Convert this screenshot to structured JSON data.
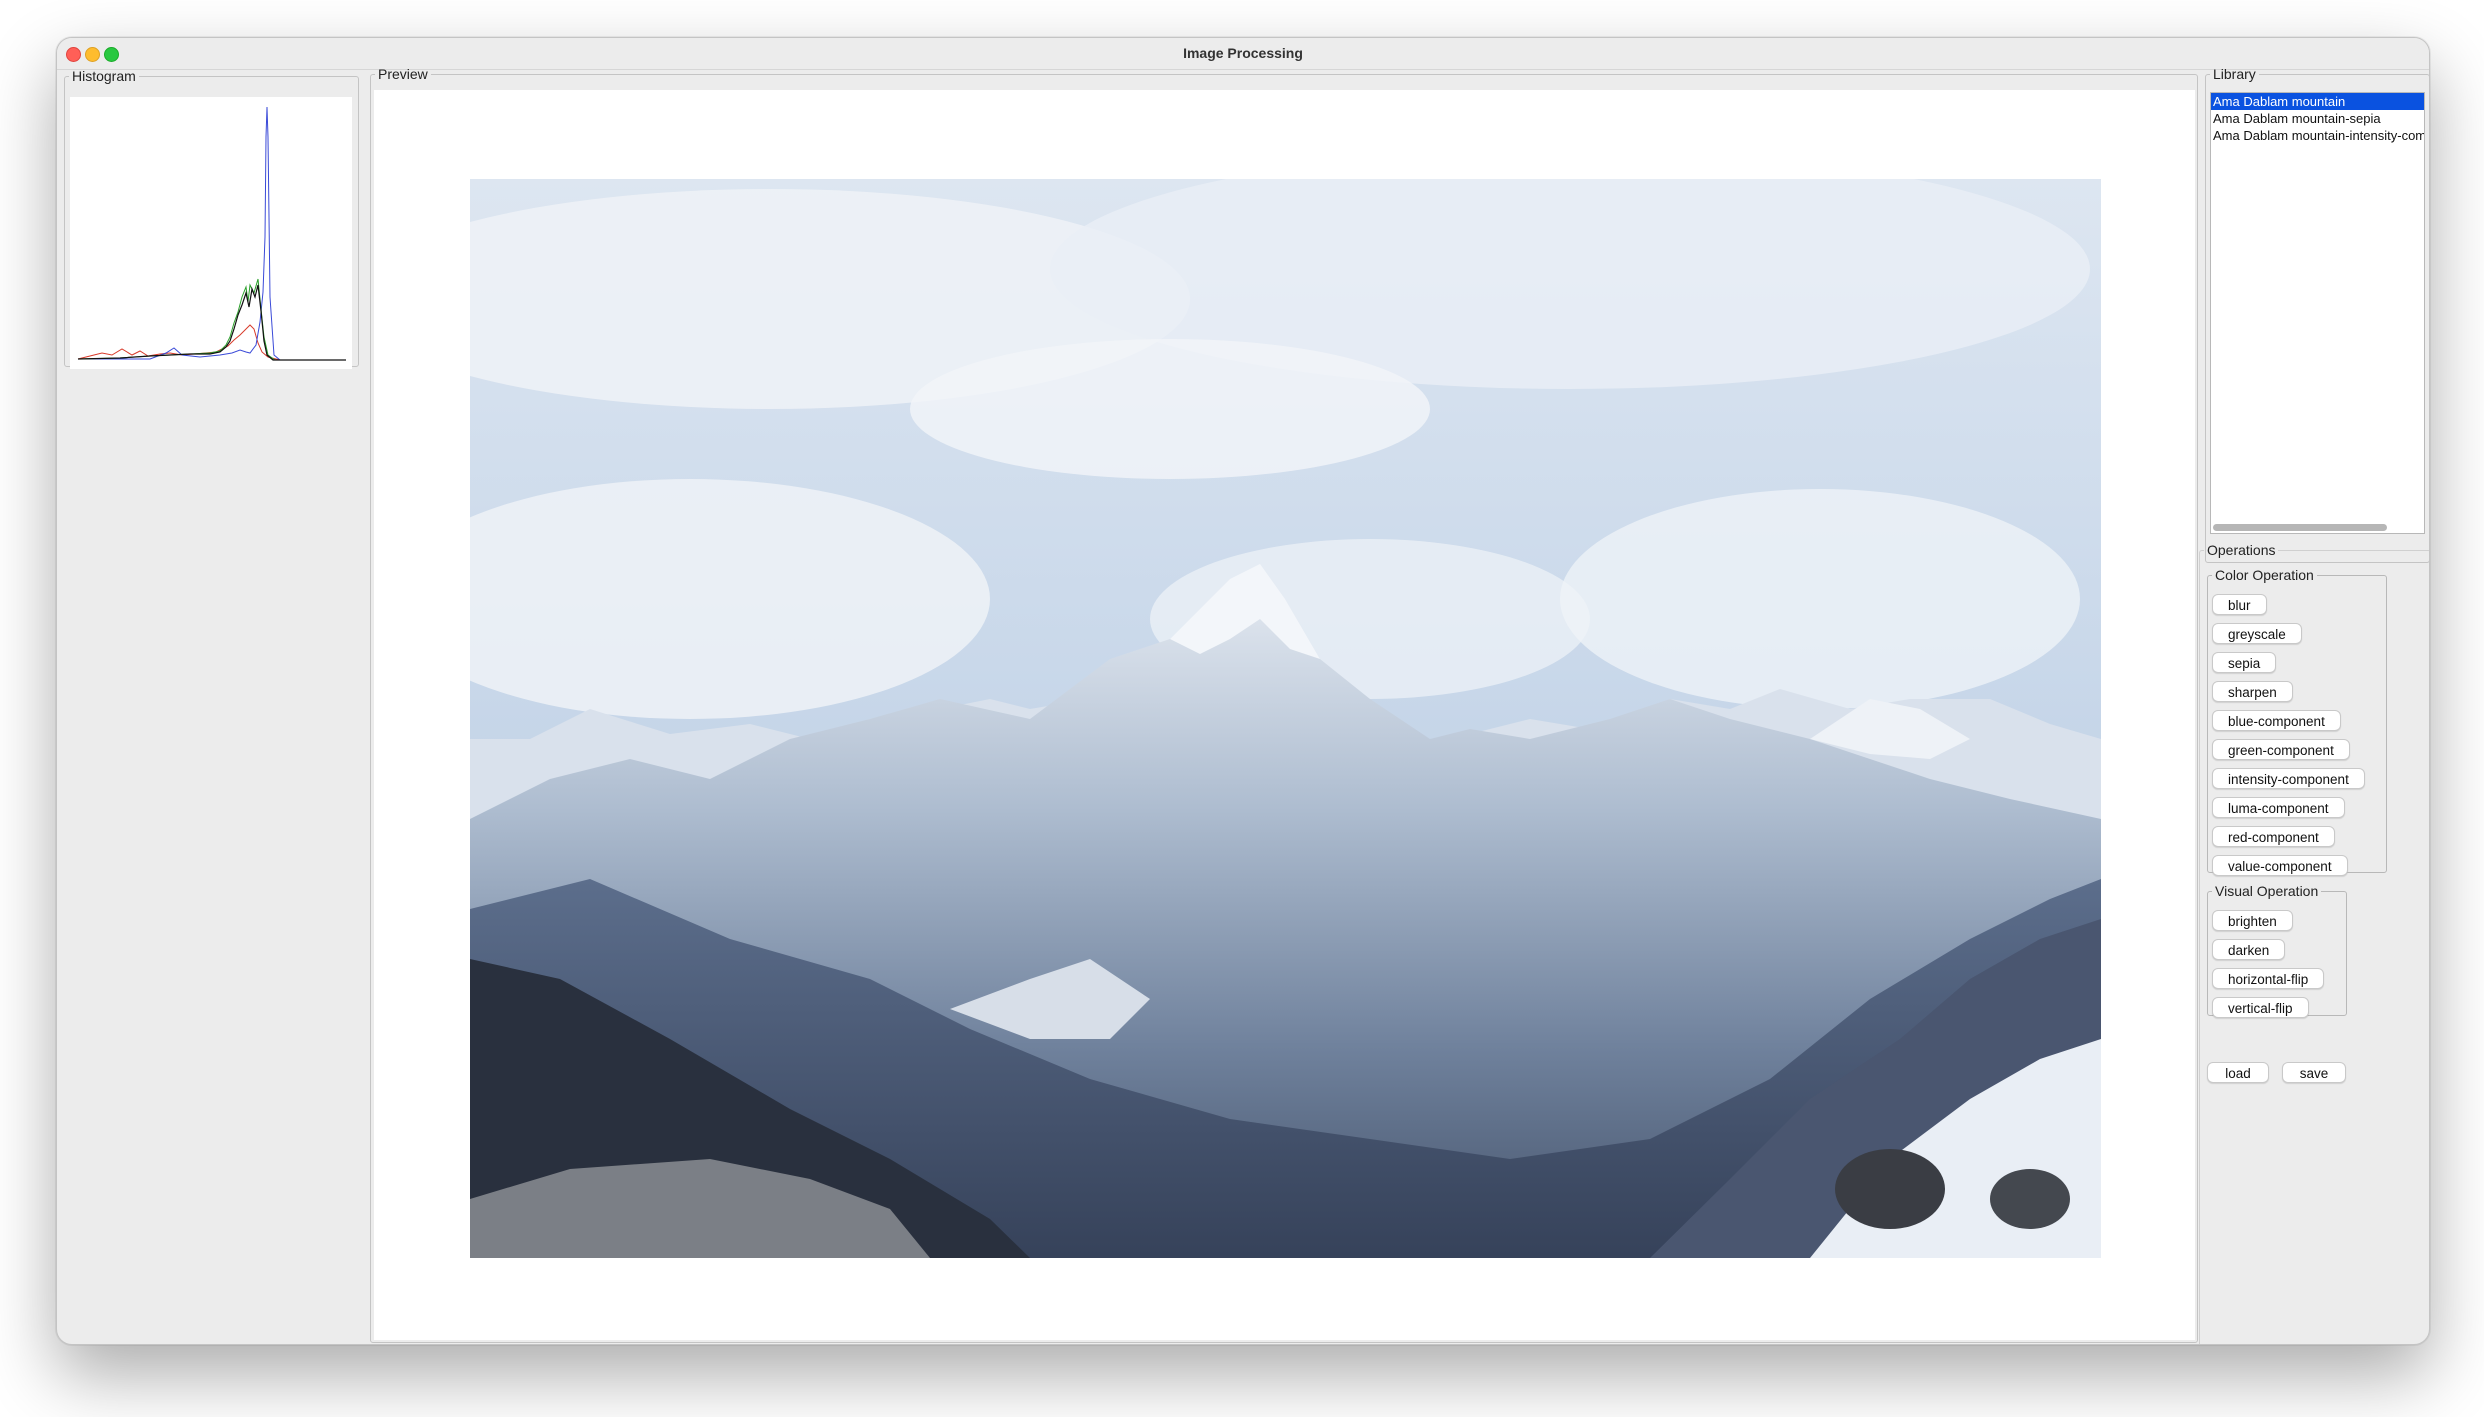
{
  "window": {
    "title": "Image Processing"
  },
  "histogram": {
    "legend": "Histogram",
    "colors": {
      "red": "#d83a2a",
      "green": "#2aa02a",
      "blue": "#3a4ad8",
      "intensity": "#111111"
    }
  },
  "preview": {
    "legend": "Preview"
  },
  "library": {
    "legend": "Library",
    "items": [
      {
        "label": "Ama Dablam mountain",
        "selected": true
      },
      {
        "label": "Ama Dablam mountain-sepia",
        "selected": false
      },
      {
        "label": "Ama Dablam mountain-intensity-component",
        "selected": false
      }
    ]
  },
  "operations": {
    "legend": "Operations",
    "color": {
      "legend": "Color Operation",
      "buttons": [
        "blur",
        "greyscale",
        "sepia",
        "sharpen",
        "blue-component",
        "green-component",
        "intensity-component",
        "luma-component",
        "red-component",
        "value-component"
      ]
    },
    "visual": {
      "legend": "Visual Operation",
      "buttons": [
        "brighten",
        "darken",
        "horizontal-flip",
        "vertical-flip"
      ]
    },
    "load_label": "load",
    "save_label": "save"
  },
  "colors": {
    "selection": "#0a52e0",
    "window_bg": "#ececec"
  }
}
